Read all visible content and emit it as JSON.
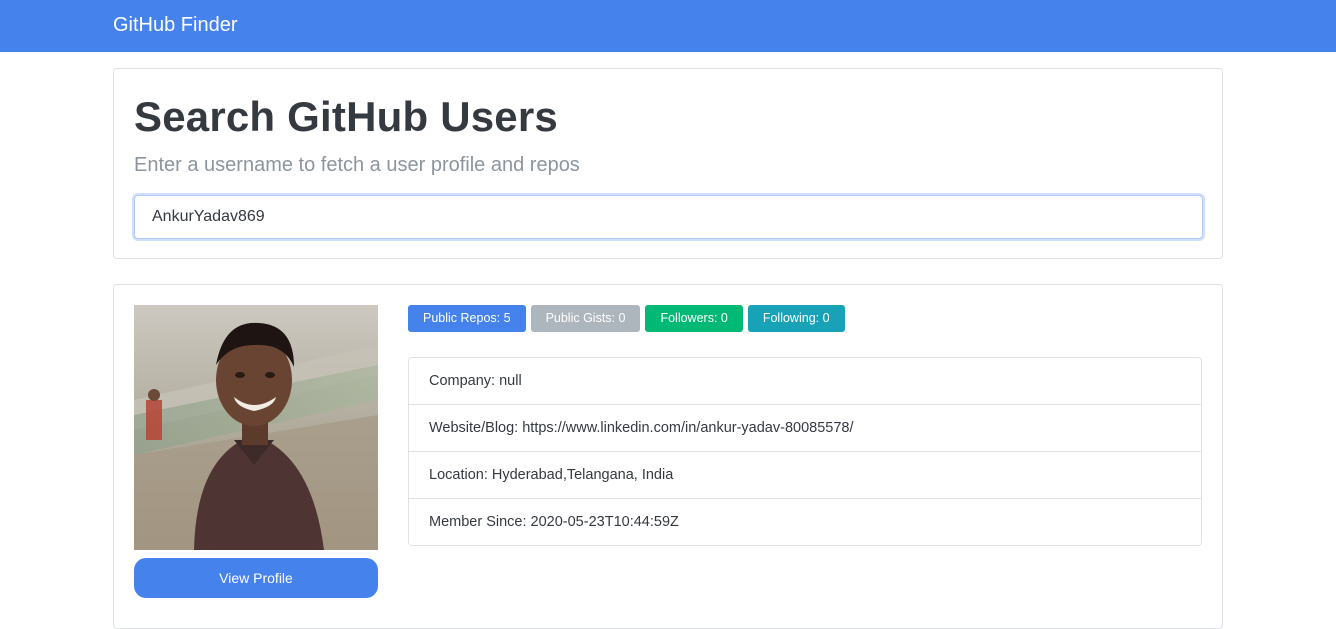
{
  "navbar": {
    "brand": "GitHub Finder"
  },
  "search": {
    "title": "Search GitHub Users",
    "subtitle": "Enter a username to fetch a user profile and repos",
    "value": "AnkurYadav869"
  },
  "profile": {
    "view_profile_label": "View Profile",
    "badges": [
      {
        "label": "Public Repos: 5",
        "color": "#4582ec"
      },
      {
        "label": "Public Gists: 0",
        "color": "#adb5bd"
      },
      {
        "label": "Followers: 0",
        "color": "#02b875"
      },
      {
        "label": "Following: 0",
        "color": "#17a2b8"
      }
    ],
    "details": [
      "Company: null",
      "Website/Blog: https://www.linkedin.com/in/ankur-yadav-80085578/",
      "Location: Hyderabad,Telangana, India",
      "Member Since: 2020-05-23T10:44:59Z"
    ]
  },
  "colors": {
    "primary": "#4582ec",
    "secondary": "#adb5bd",
    "success": "#02b875",
    "info": "#17a2b8"
  }
}
